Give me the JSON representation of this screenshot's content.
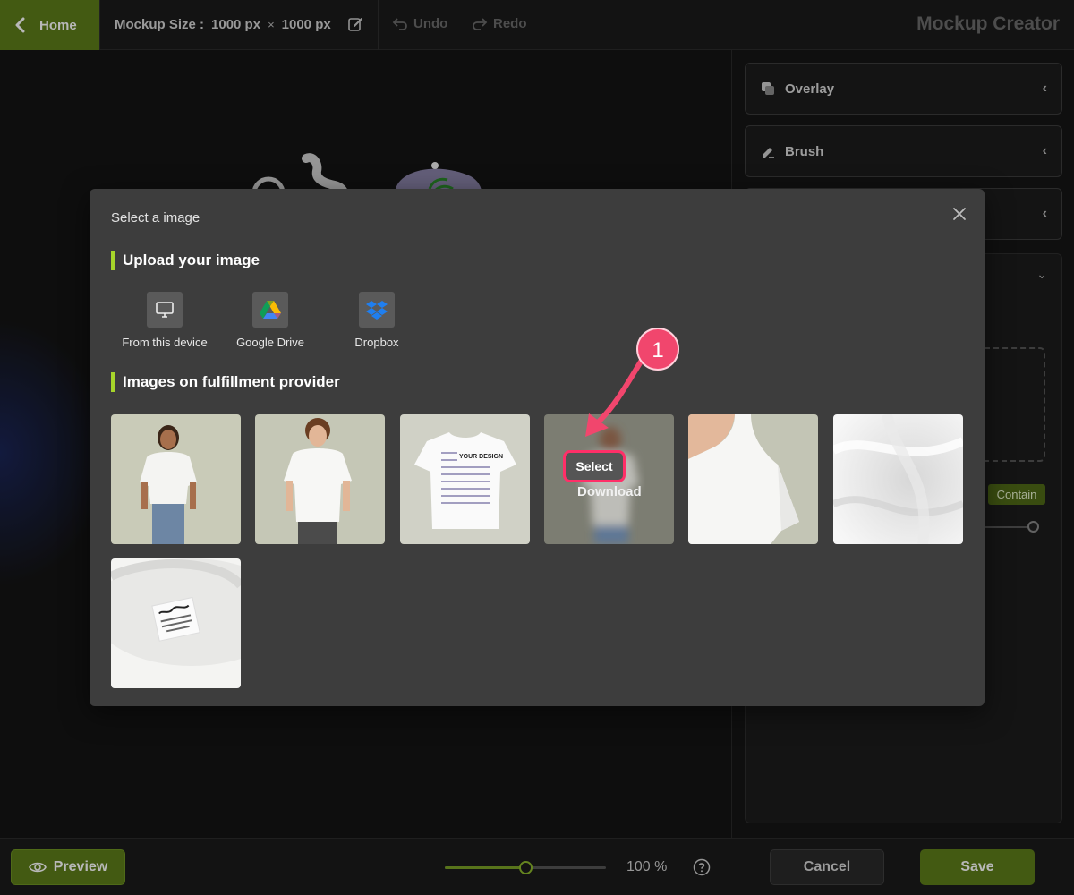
{
  "topbar": {
    "home_label": "Home",
    "mockup_size_label": "Mockup Size :",
    "width_value": "1000 px",
    "times_symbol": "×",
    "height_value": "1000 px",
    "undo_label": "Undo",
    "redo_label": "Redo",
    "app_title": "Mockup Creator"
  },
  "right_panel": {
    "accordions": [
      {
        "label": "Overlay",
        "icon": "overlay-icon"
      },
      {
        "label": "Brush",
        "icon": "brush-icon"
      },
      {
        "label": "",
        "icon": ""
      }
    ],
    "contain_label": "Contain"
  },
  "bottombar": {
    "preview_label": "Preview",
    "zoom_value": "100 %",
    "zoom_level": 0.5,
    "cancel_label": "Cancel",
    "save_label": "Save"
  },
  "modal": {
    "title": "Select a image",
    "upload_heading": "Upload your image",
    "sources": [
      {
        "label": "From this device",
        "icon": "monitor-icon"
      },
      {
        "label": "Google Drive",
        "icon": "google-drive-icon"
      },
      {
        "label": "Dropbox",
        "icon": "dropbox-icon"
      }
    ],
    "provider_heading": "Images on fulfillment provider",
    "images": [
      {
        "name": "woman-white-tee"
      },
      {
        "name": "man-white-tee"
      },
      {
        "name": "flat-tee-your-design",
        "text": "YOUR DESIGN"
      },
      {
        "name": "blurred-model-hover"
      },
      {
        "name": "shoulder-closeup"
      },
      {
        "name": "fabric-texture"
      },
      {
        "name": "neck-label"
      }
    ],
    "hover_actions": {
      "select_label": "Select",
      "download_label": "Download"
    },
    "step_number": "1"
  },
  "colors": {
    "accent_green": "#5e7d1a",
    "highlight_pink": "#ff2f68",
    "heading_bar": "#a6d52a"
  }
}
